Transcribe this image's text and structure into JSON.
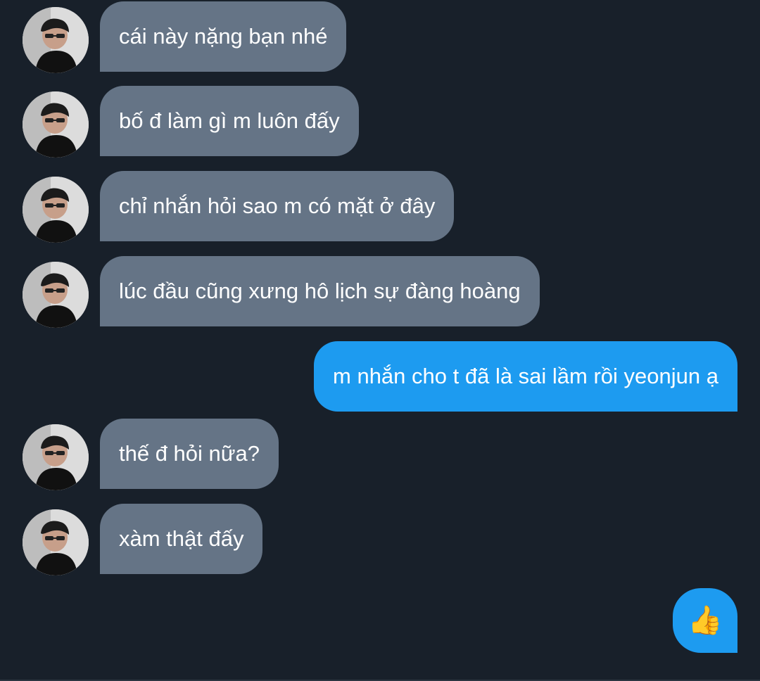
{
  "messages": [
    {
      "side": "in",
      "text": "cái này nặng bạn nhé"
    },
    {
      "side": "in",
      "text": "bố đ làm gì m luôn đấy"
    },
    {
      "side": "in",
      "text": "chỉ nhắn hỏi sao m có mặt ở đây"
    },
    {
      "side": "in",
      "text": "lúc đầu cũng xưng hô lịch sự đàng hoàng"
    },
    {
      "side": "out",
      "text": "m nhắn cho t đã là sai lầm rồi yeonjun ạ"
    },
    {
      "side": "in",
      "text": "thế đ hỏi nữa?"
    },
    {
      "side": "in",
      "text": "xàm thật đấy"
    }
  ],
  "final_reaction": {
    "emoji": "👍",
    "name": "thumbs-up-icon"
  },
  "colors": {
    "background": "#18202a",
    "incoming_bubble": "#657486",
    "outgoing_bubble": "#1d9bf0",
    "text": "#ffffff"
  }
}
